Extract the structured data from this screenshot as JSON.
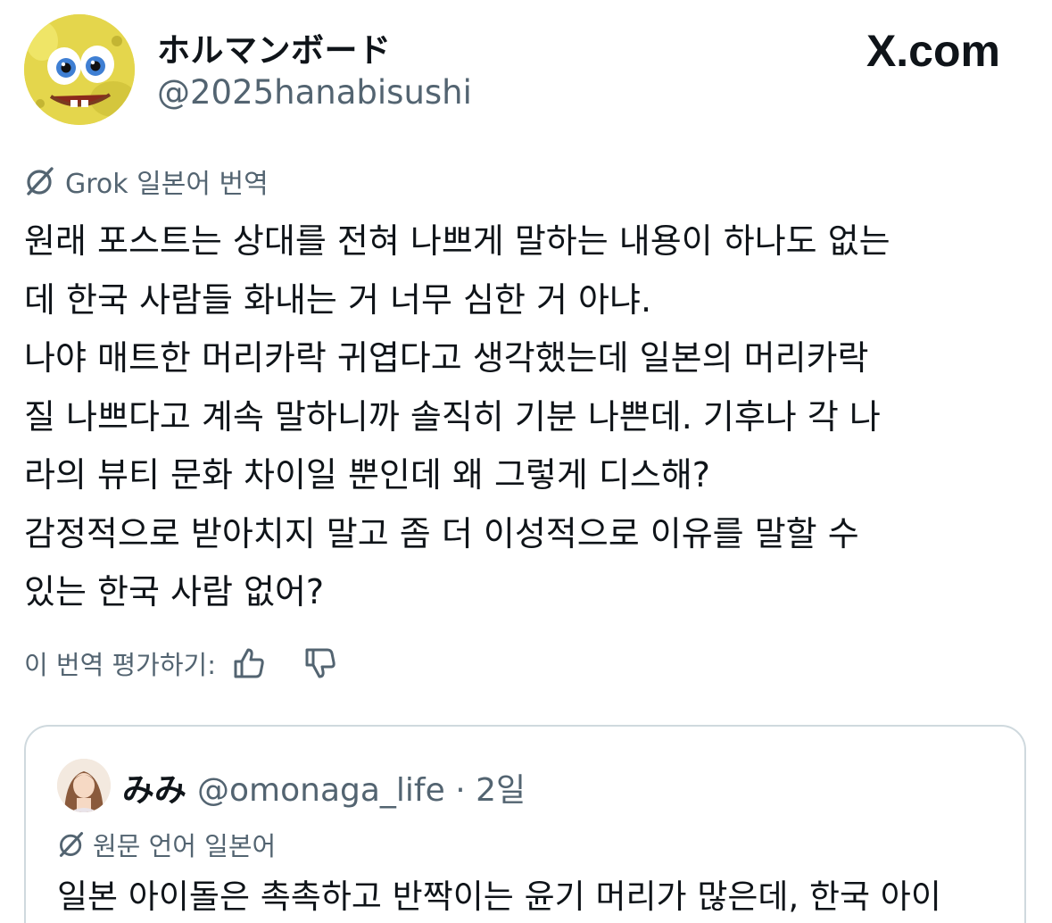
{
  "brand": {
    "label": "X.com"
  },
  "author": {
    "display_name": "ホルマンボード",
    "handle": "@2025hanabisushi",
    "avatar_icon": "spongebob-avatar"
  },
  "translation": {
    "icon": "grok-icon",
    "label": "Grok 일본어 번역"
  },
  "post": {
    "text": "원래 포스트는 상대를 전혀 나쁘게 말하는 내용이 하나도 없는\n데 한국 사람들 화내는 거 너무 심한 거 아냐.\n나야 매트한 머리카락 귀엽다고 생각했는데 일본의 머리카락\n질 나쁘다고 계속 말하니까 솔직히 기분 나쁜데. 기후나 각 나\n라의 뷰티 문화 차이일 뿐인데 왜 그렇게 디스해?\n감정적으로 받아치지 말고 좀 더 이성적으로 이유를 말할 수\n있는 한국 사람 없어?"
  },
  "rating": {
    "label": "이 번역 평가하기:",
    "thumbs_up_icon": "thumbs-up-icon",
    "thumbs_down_icon": "thumbs-down-icon"
  },
  "quoted": {
    "display_name": "みみ",
    "handle": "@omonaga_life",
    "separator": " · ",
    "time": "2일",
    "lang_label": "원문 언어 일본어",
    "text": "일본 아이돌은 촉촉하고 반짝이는 윤기 머리가 많은데, 한국 아이"
  },
  "colors": {
    "text_primary": "#0f1419",
    "text_secondary": "#536471",
    "border": "#cfd9de"
  }
}
